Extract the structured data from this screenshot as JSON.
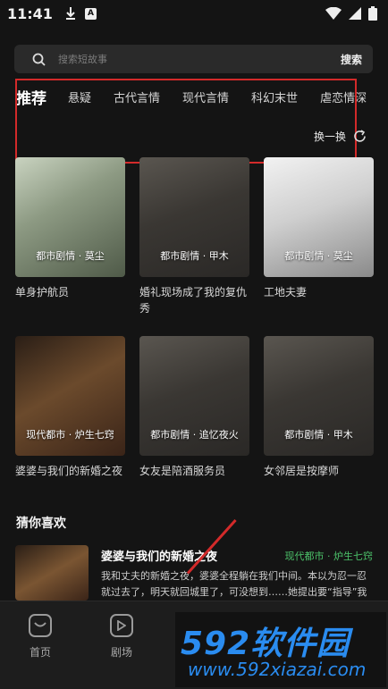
{
  "status_bar": {
    "time": "11:41"
  },
  "search": {
    "placeholder": "搜索短故事",
    "button": "搜索"
  },
  "tabs": [
    "推荐",
    "悬疑",
    "古代言情",
    "现代言情",
    "科幻末世",
    "虐恋情深"
  ],
  "refresh_label": "换一换",
  "cards": [
    {
      "cover_label": "都市剧情 · 莫尘",
      "title": "单身护航员"
    },
    {
      "cover_label": "都市剧情 · 甲木",
      "title": "婚礼现场成了我的复仇秀"
    },
    {
      "cover_label": "都市剧情 · 莫尘",
      "title": "工地夫妻"
    },
    {
      "cover_label": "现代都市 · 炉生七窍",
      "title": "婆婆与我们的新婚之夜"
    },
    {
      "cover_label": "都市剧情 · 追忆夜火",
      "title": "女友是陪酒服务员"
    },
    {
      "cover_label": "都市剧情 · 甲木",
      "title": "女邻居是按摩师"
    }
  ],
  "section_title": "猜你喜欢",
  "recommendation": {
    "title": "婆婆与我们的新婚之夜",
    "tag": "现代都市 · 炉生七窍",
    "description": "我和丈夫的新婚之夜，婆婆全程躺在我们中间。本以为忍一忍就过去了，明天就回城里了，可没想到……她提出要“指导”我"
  },
  "bottom_nav": [
    {
      "label": "首页",
      "icon": "home-icon"
    },
    {
      "label": "剧场",
      "icon": "play-icon"
    }
  ],
  "watermark": {
    "main": "592软件园",
    "url": "www.592xiazai.com"
  }
}
